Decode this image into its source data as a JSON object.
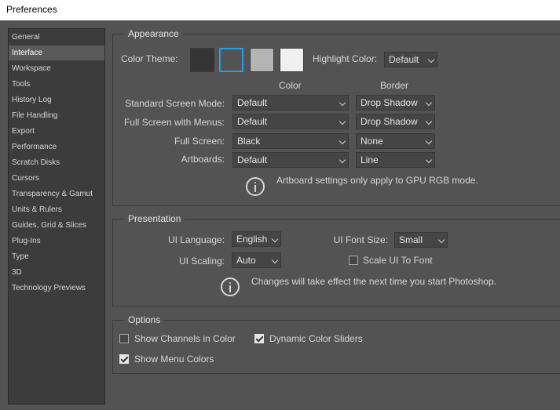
{
  "window": {
    "title": "Preferences"
  },
  "sidebar": {
    "items": [
      {
        "label": "General"
      },
      {
        "label": "Interface",
        "selected": true
      },
      {
        "label": "Workspace"
      },
      {
        "label": "Tools"
      },
      {
        "label": "History Log"
      },
      {
        "label": "File Handling"
      },
      {
        "label": "Export"
      },
      {
        "label": "Performance"
      },
      {
        "label": "Scratch Disks"
      },
      {
        "label": "Cursors"
      },
      {
        "label": "Transparency & Gamut"
      },
      {
        "label": "Units & Rulers"
      },
      {
        "label": "Guides, Grid & Slices"
      },
      {
        "label": "Plug-Ins"
      },
      {
        "label": "Type"
      },
      {
        "label": "3D"
      },
      {
        "label": "Technology Previews"
      }
    ]
  },
  "appearance": {
    "title": "Appearance",
    "color_theme_label": "Color Theme:",
    "color_themes": [
      "#353535",
      "#535353",
      "#b4b4b4",
      "#f0f0f0"
    ],
    "selected_theme_index": 1,
    "highlight_label": "Highlight Color:",
    "highlight_value": "Default",
    "col_color": "Color",
    "col_border": "Border",
    "rows": [
      {
        "label": "Standard Screen Mode:",
        "color": "Default",
        "border": "Drop Shadow"
      },
      {
        "label": "Full Screen with Menus:",
        "color": "Default",
        "border": "Drop Shadow"
      },
      {
        "label": "Full Screen:",
        "color": "Black",
        "border": "None"
      },
      {
        "label": "Artboards:",
        "color": "Default",
        "border": "Line"
      }
    ],
    "info": "Artboard settings only apply to GPU RGB mode."
  },
  "presentation": {
    "title": "Presentation",
    "ui_language_label": "UI Language:",
    "ui_language": "English",
    "ui_font_size_label": "UI Font Size:",
    "ui_font_size": "Small",
    "ui_scaling_label": "UI Scaling:",
    "ui_scaling": "Auto",
    "scale_ui_label": "Scale UI To Font",
    "scale_ui_checked": false,
    "info": "Changes will take effect the next time you start Photoshop."
  },
  "options": {
    "title": "Options",
    "show_channels_label": "Show Channels in Color",
    "show_channels_checked": false,
    "dynamic_sliders_label": "Dynamic Color Sliders",
    "dynamic_sliders_checked": true,
    "show_menu_colors_label": "Show Menu Colors",
    "show_menu_colors_checked": true
  }
}
